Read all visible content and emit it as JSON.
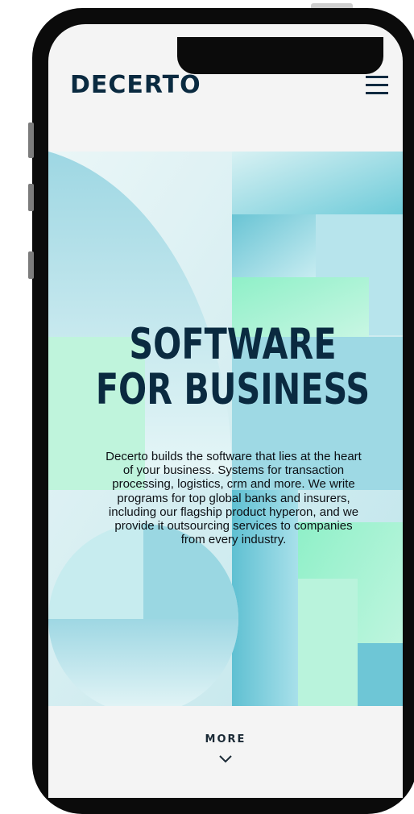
{
  "header": {
    "logo_text": "DECERTO",
    "menu_icon": "hamburger-menu-icon"
  },
  "hero": {
    "title_line1": "SOFTWARE",
    "title_line2": "FOR BUSINESS",
    "description_lines": [
      "Decerto builds the software that lies at the heart",
      "of your business. Systems for transaction",
      "processing, logistics, crm and more. We write",
      "programs for top global banks and insurers,",
      "including our flagship product hyperon, and we",
      "provide it outsourcing services to companies",
      "from every industry."
    ]
  },
  "more": {
    "label": "MORE",
    "icon": "chevron-down-icon"
  },
  "colors": {
    "brand_text": "#0a2a40",
    "teal": "#5fc6d6",
    "mint": "#9aefc9",
    "screen_bg": "#f4f4f4"
  }
}
